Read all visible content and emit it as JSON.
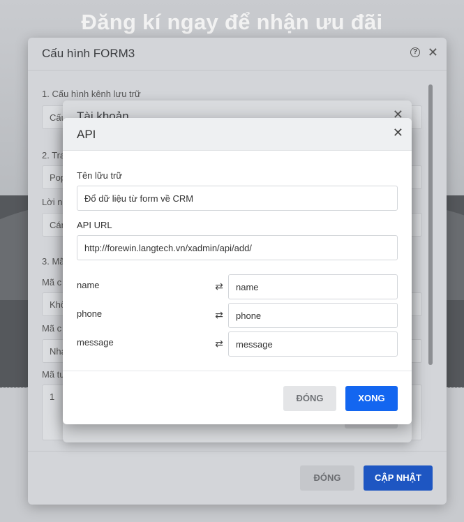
{
  "background": {
    "headline": "Đăng kí ngay để nhận ưu đãi"
  },
  "form_modal": {
    "title": "Cấu hình FORM3",
    "help_icon": "question-circle-icon",
    "close_icon": "close-icon",
    "section1_label": "1. Cấu hình kênh lưu trữ",
    "section1_value": "Cấu",
    "section2_label": "2. Tra",
    "section2_value": "Pop",
    "message_label": "Lời n",
    "message_value": "Cám",
    "section3_label": "3. Mã",
    "code_label_1": "Mã c",
    "code_value_1": "Khô",
    "code_label_2": "Mã c",
    "code_value_2": "Nha",
    "code_label_3": "Mã tu",
    "code_line_no": "1",
    "cancel_label": "ĐÓNG",
    "update_label": "CẬP NHẬT"
  },
  "account_modal": {
    "title": "Tài khoản",
    "close_icon": "close-icon"
  },
  "api_modal": {
    "title": "API",
    "close_icon": "close-icon",
    "storage_name_label": "Tên lữu trữ",
    "storage_name_value": "Đổ dữ liệu từ form về CRM",
    "api_url_label": "API URL",
    "api_url_value": "http://forewin.langtech.vn/xadmin/api/add/",
    "mappings": [
      {
        "field": "name",
        "icon": "swap-icon",
        "value": "name"
      },
      {
        "field": "phone",
        "icon": "swap-icon",
        "value": "phone"
      },
      {
        "field": "message",
        "icon": "swap-icon",
        "value": "message"
      }
    ],
    "cancel_label": "ĐÓNG",
    "done_label": "XONG"
  },
  "colors": {
    "primary": "#1366f0",
    "update_button": "#1e56c2"
  }
}
